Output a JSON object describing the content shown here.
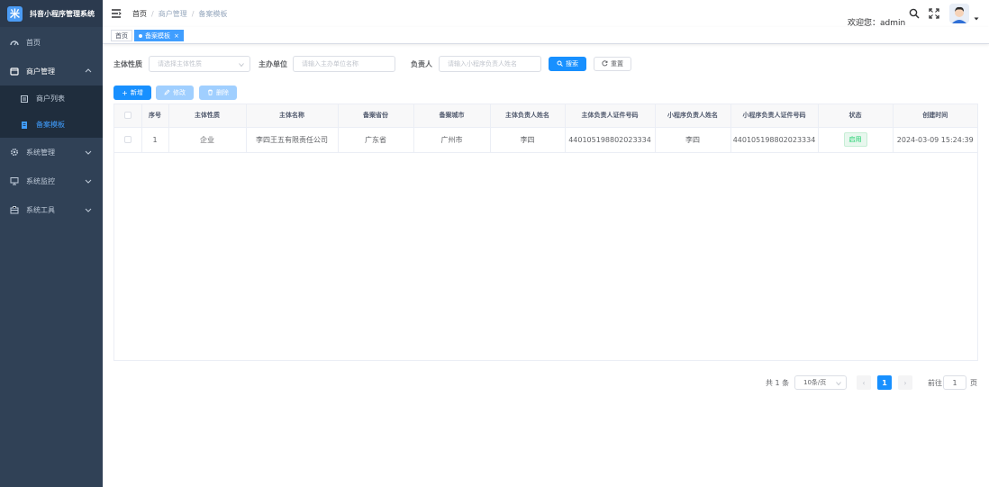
{
  "app": {
    "title": "抖音小程序管理系统",
    "logo_glyph": "米"
  },
  "sidebar": {
    "items": [
      {
        "label": "首页",
        "icon": "dashboard-icon"
      },
      {
        "label": "商户管理",
        "icon": "shop-icon",
        "children": [
          {
            "label": "商户列表",
            "icon": "list-icon"
          },
          {
            "label": "备案模板",
            "icon": "document-icon",
            "active": true
          }
        ]
      },
      {
        "label": "系统管理",
        "icon": "gear-icon"
      },
      {
        "label": "系统监控",
        "icon": "monitor-icon"
      },
      {
        "label": "系统工具",
        "icon": "toolbox-icon"
      }
    ]
  },
  "header": {
    "breadcrumb": [
      "首页",
      "商户管理",
      "备案模板"
    ],
    "welcome": "欢迎您：admin"
  },
  "tags": {
    "home": "首页",
    "current": "备案模板"
  },
  "search": {
    "label_entity_type": "主体性质",
    "placeholder_entity_type": "请选择主体性质",
    "label_organizer": "主办单位",
    "placeholder_organizer": "请输入主办单位名称",
    "label_owner": "负责人",
    "placeholder_owner": "请输入小程序负责人姓名",
    "search_btn": "搜索",
    "reset_btn": "重置"
  },
  "toolbar": {
    "add": "新增",
    "edit": "修改",
    "delete": "删除"
  },
  "table": {
    "headers": [
      "序号",
      "主体性质",
      "主体名称",
      "备案省份",
      "备案城市",
      "主体负责人姓名",
      "主体负责人证件号码",
      "小程序负责人姓名",
      "小程序负责人证件号码",
      "状态",
      "创建时间"
    ],
    "rows": [
      [
        "1",
        "企业",
        "李四王五有限责任公司",
        "广东省",
        "广州市",
        "李四",
        "440105198802023334",
        "李四",
        "440105198802023334",
        "启用",
        "2024-03-09 15:24:39"
      ]
    ]
  },
  "pagination": {
    "total": "共 1 条",
    "page_size": "10条/页",
    "current_page": "1",
    "goto_label": "前往",
    "goto_value": "1",
    "page_unit": "页"
  },
  "colors": {
    "sidebar_bg": "#304156",
    "primary": "#1890ff",
    "active_menu": "#409eff",
    "status_green": "#13ce66"
  }
}
